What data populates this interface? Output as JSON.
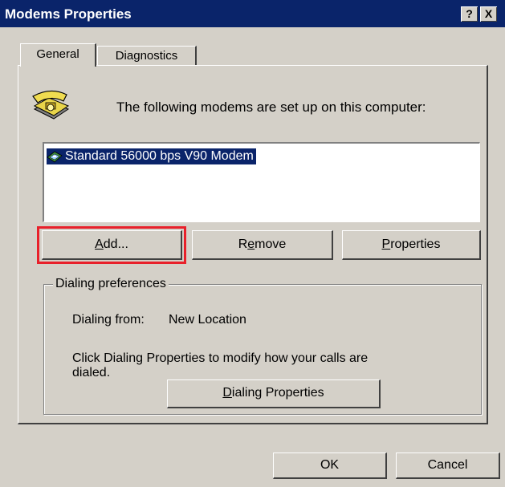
{
  "window": {
    "title": "Modems Properties",
    "help_button": "?",
    "close_button": "X"
  },
  "tabs": [
    {
      "label": "General",
      "selected": true
    },
    {
      "label": "Diagnostics",
      "selected": false
    }
  ],
  "general": {
    "intro_text": "The following modems are set up on this computer:",
    "modems": [
      "Standard 56000 bps V90 Modem"
    ],
    "buttons": {
      "add": {
        "pre": "",
        "mnemonic": "A",
        "post": "dd..."
      },
      "remove": {
        "pre": "R",
        "mnemonic": "e",
        "post": "move"
      },
      "properties": {
        "pre": "",
        "mnemonic": "P",
        "post": "roperties"
      }
    },
    "dialing": {
      "group_label": "Dialing preferences",
      "from_label": "Dialing from:",
      "from_value": "New Location",
      "info_line1": "Click Dialing Properties to modify how your calls are",
      "info_line2": "dialed.",
      "button": {
        "pre": "",
        "mnemonic": "D",
        "post": "ialing Properties"
      }
    }
  },
  "footer": {
    "ok_label": "OK",
    "cancel_label": "Cancel"
  },
  "colors": {
    "face": "#d4d0c8",
    "titlebar": "#0a246a",
    "selection": "#0a246a",
    "highlight_box": "#e8202a"
  }
}
